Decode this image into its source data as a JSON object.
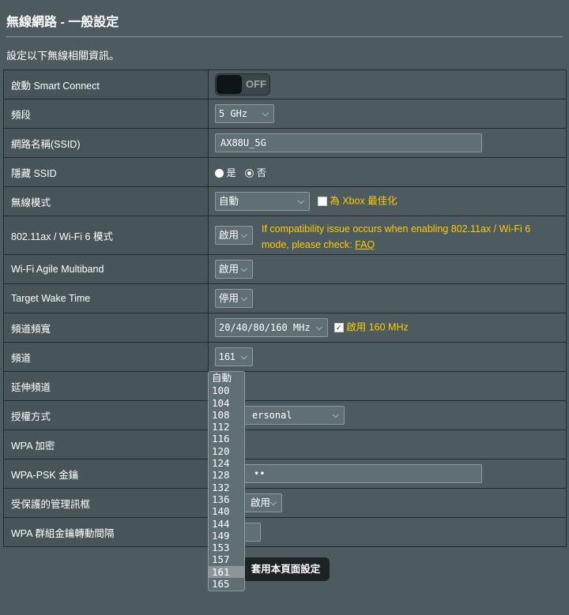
{
  "header": {
    "title": "無線網路 - 一般設定",
    "subtitle": "設定以下無線相關資訊。"
  },
  "rows": {
    "smart_connect": {
      "label": "啟動 Smart Connect",
      "toggle": "OFF"
    },
    "band": {
      "label": "頻段",
      "value": "5 GHz"
    },
    "ssid": {
      "label": "網路名稱(SSID)",
      "value": "AX88U_5G"
    },
    "hide_ssid": {
      "label": "隱藏 SSID",
      "opt_yes": "是",
      "opt_no": "否"
    },
    "wireless_mode": {
      "label": "無線模式",
      "value": "自動",
      "xbox_label": "為 Xbox 最佳化"
    },
    "ax_mode": {
      "label": "802.11ax / Wi-Fi 6 模式",
      "value": "啟用",
      "warning": "If compatibility issue occurs when enabling 802.11ax / Wi-Fi 6 mode, please check:",
      "faq": "FAQ"
    },
    "agile_multiband": {
      "label": "Wi-Fi Agile Multiband",
      "value": "啟用"
    },
    "twt": {
      "label": "Target Wake Time",
      "value": "停用"
    },
    "bandwidth": {
      "label": "頻道頻寬",
      "value": "20/40/80/160 MHz",
      "enable_160": "啟用 160 MHz"
    },
    "channel": {
      "label": "頻道",
      "value": "161"
    },
    "ext_channel": {
      "label": "延伸頻道"
    },
    "auth": {
      "label": "授權方式",
      "value_visible": "ersonal"
    },
    "wpa_enc": {
      "label": "WPA 加密"
    },
    "psk": {
      "label": "WPA-PSK 金鑰",
      "value_visible": "••"
    },
    "pmf": {
      "label": "受保護的管理訊框",
      "value_visible": "啟用"
    },
    "gtk": {
      "label": "WPA 群組金鑰轉動間隔"
    }
  },
  "channel_dropdown": {
    "options": [
      "自動",
      "100",
      "104",
      "108",
      "112",
      "116",
      "120",
      "124",
      "128",
      "132",
      "136",
      "140",
      "144",
      "149",
      "153",
      "157",
      "161",
      "165"
    ],
    "selected": "161"
  },
  "apply_button": "套用本頁面設定",
  "colors": {
    "background": "#4d5a5e",
    "label_cell": "#475458",
    "warning": "#ffcc00",
    "button": "#1d2224"
  }
}
